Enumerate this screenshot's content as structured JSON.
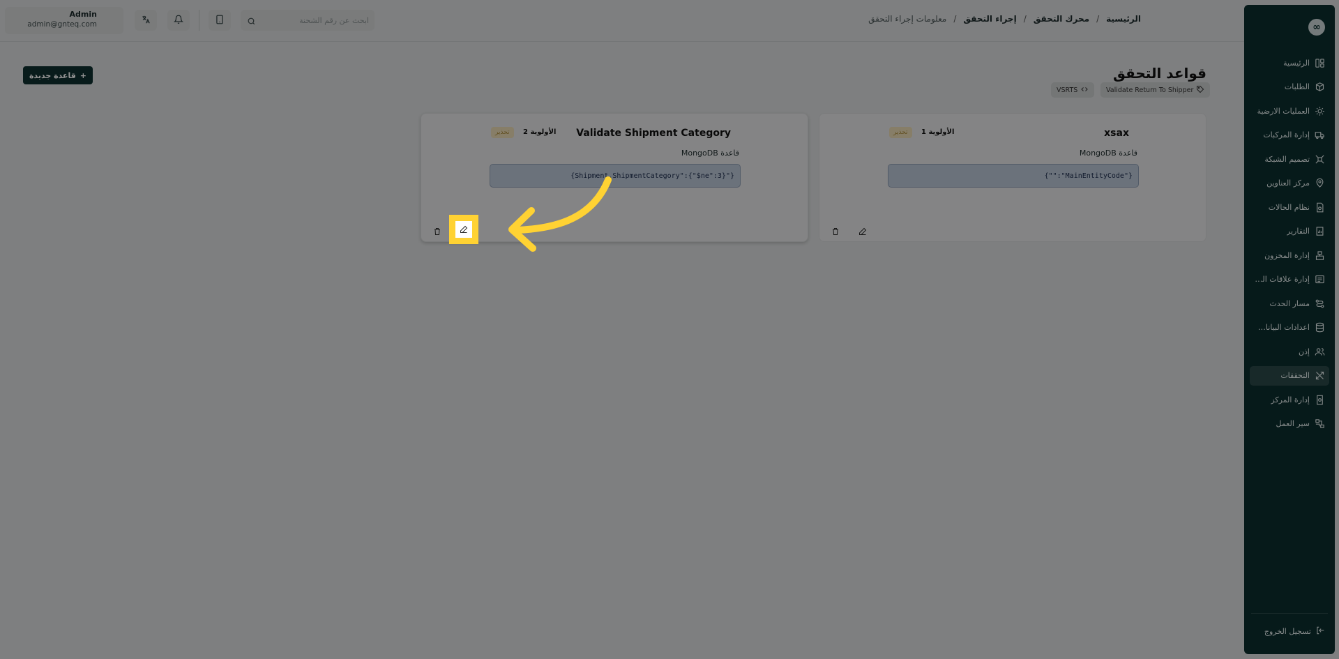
{
  "sidebar": {
    "logo": "∞",
    "items": [
      {
        "label": "الرئيسية",
        "icon": "layout-icon",
        "active": false
      },
      {
        "label": "الطلبات",
        "icon": "package-icon",
        "active": false
      },
      {
        "label": "العمليات الارضية",
        "icon": "sun-icon",
        "active": false
      },
      {
        "label": "إدارة المركبات",
        "icon": "truck-icon",
        "active": false
      },
      {
        "label": "تصميم الشبكة",
        "icon": "network-icon",
        "active": false
      },
      {
        "label": "مركز العناوين",
        "icon": "map-pin-icon",
        "active": false
      },
      {
        "label": "نظام الحالات",
        "icon": "file-status-icon",
        "active": false
      },
      {
        "label": "التقارير",
        "icon": "report-icon",
        "active": false
      },
      {
        "label": "إدارة المخزون",
        "icon": "inventory-icon",
        "active": false
      },
      {
        "label": "إدارة علاقات العملاء",
        "icon": "crm-icon",
        "active": false
      },
      {
        "label": "مسار الحدث",
        "icon": "route-icon",
        "active": false
      },
      {
        "label": "اعدادات البيانات...",
        "icon": "database-icon",
        "active": false
      },
      {
        "label": "إذن",
        "icon": "users-icon",
        "active": false
      },
      {
        "label": "التحققات",
        "icon": "tools-icon",
        "active": true
      },
      {
        "label": "إدارة المركز",
        "icon": "center-icon",
        "active": false
      },
      {
        "label": "سير العمل",
        "icon": "workflow-icon",
        "active": false
      }
    ],
    "logout_label": "تسجيل الخروج"
  },
  "header": {
    "user_name": "Admin",
    "user_email": "admin@gnteq.com",
    "search_placeholder": "ابحث عن رقم الشحنة",
    "breadcrumb": [
      "الرئيسية",
      "محرك التحقق",
      "إجراء التحقق",
      "معلومات إجراء التحقق"
    ]
  },
  "main": {
    "title": "قواعد التحقق",
    "new_rule_label": "قاعدة جديدة",
    "tags": {
      "name": "Validate Return To Shipper",
      "code": "VSRTS"
    },
    "cards": [
      {
        "title": "xsax",
        "priority": "الأولوية 1",
        "level": "تحذير",
        "type": "قاعدة MongoDB",
        "query": "{\"\":\"MainEntityCode\"}"
      },
      {
        "title": "Validate Shipment Category",
        "priority": "الأولوية 2",
        "level": "تحذير",
        "type": "قاعدة MongoDB",
        "query": "{Shipment.ShipmentCategory\":{\"$ne\":3}\"}"
      }
    ]
  },
  "colors": {
    "sidebar_bg": "#0c2d2e",
    "highlight": "#ffd233",
    "warning_badge_bg": "#e8d9b3",
    "query_bg": "#b9c5d4"
  }
}
